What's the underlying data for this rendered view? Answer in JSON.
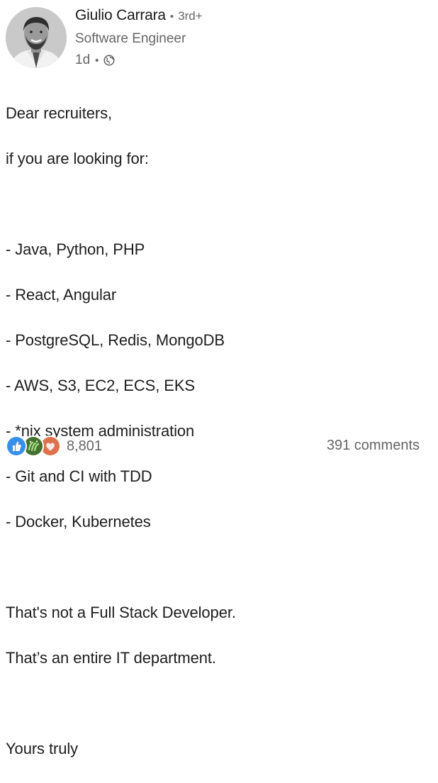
{
  "post": {
    "author": {
      "name": "Giulio Carrara",
      "separator": "•",
      "degree": "3rd+",
      "headline": "Software Engineer"
    },
    "time": "1d",
    "meta_separator": "•",
    "visibility_icon": "globe-icon",
    "text_lines": [
      "Dear recruiters,",
      "if you are looking for:",
      "",
      "- Java, Python, PHP",
      "- React, Angular",
      "- PostgreSQL, Redis, MongoDB",
      "- AWS, S3, EC2, ECS, EKS",
      "- *nix system administration",
      "- Git and CI with TDD",
      "- Docker, Kubernetes",
      "",
      "That's not a Full Stack Developer.",
      "That’s an entire IT department.",
      "",
      "Yours truly"
    ],
    "social": {
      "reaction_icons": [
        "like-icon",
        "celebrate-icon",
        "love-icon"
      ],
      "reaction_count": "8,801",
      "comments": "391 comments"
    }
  },
  "colors": {
    "like": "#378fe9",
    "celebrate": "#44712e",
    "love": "#df704d",
    "text": "#1d1d1d",
    "muted": "#666666"
  }
}
